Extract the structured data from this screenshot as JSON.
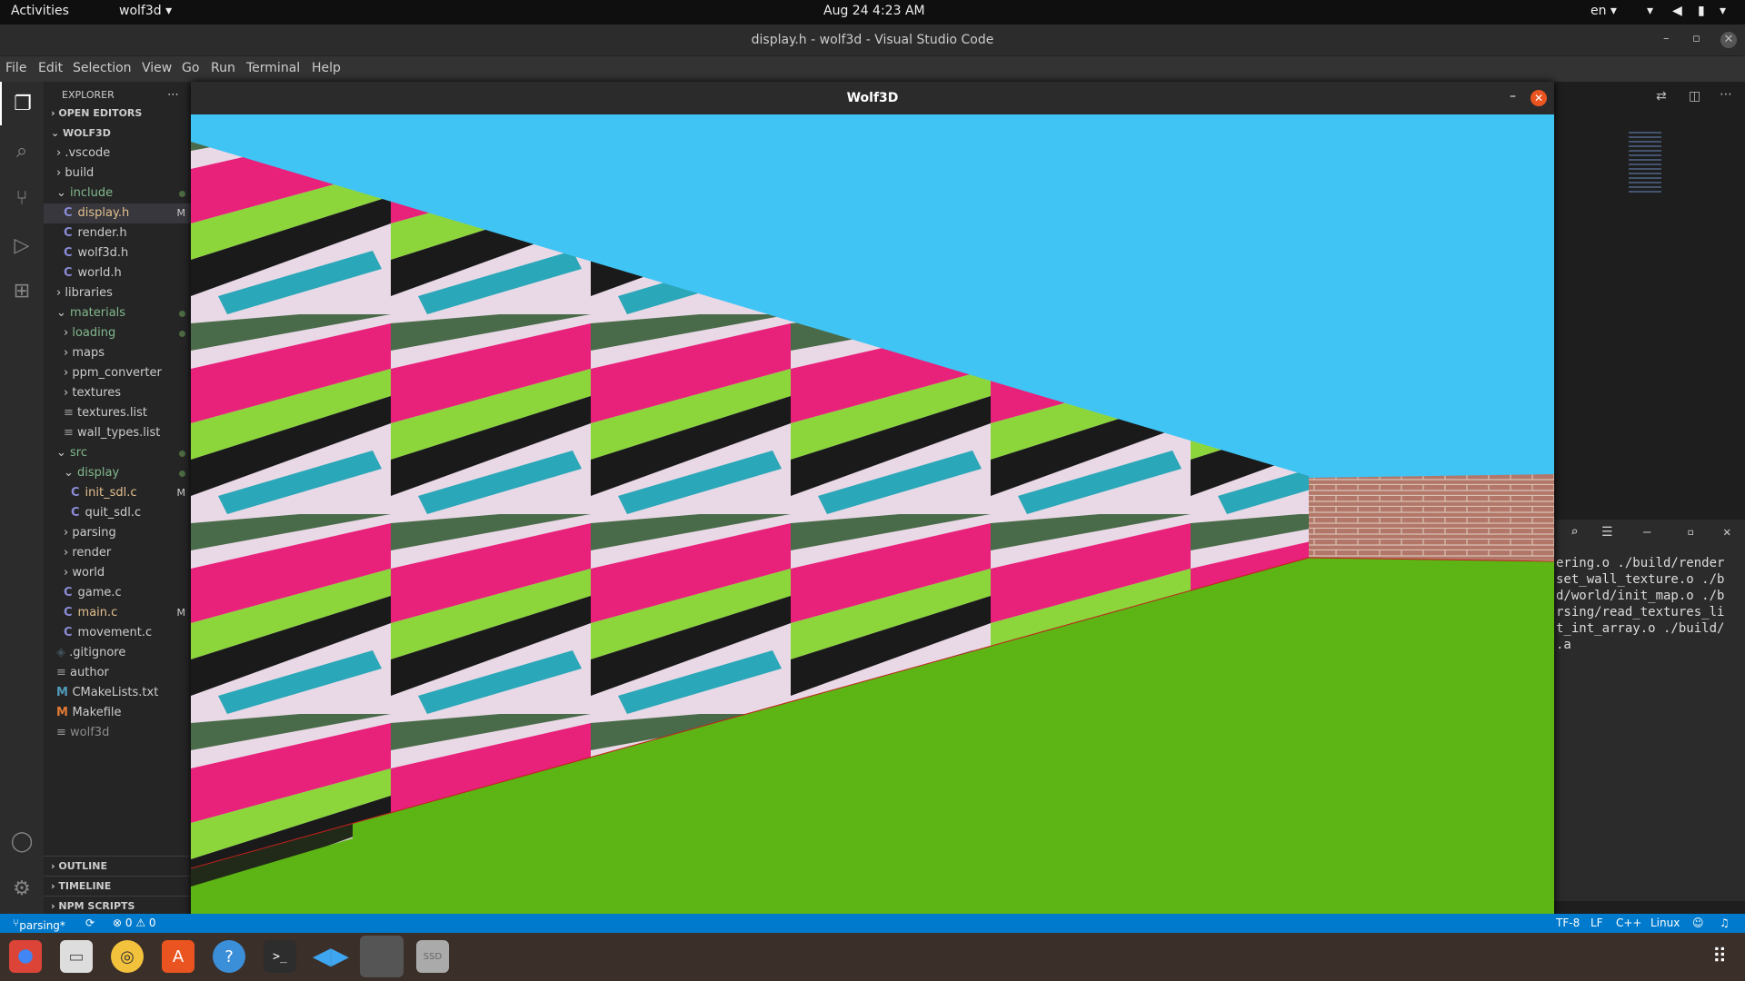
{
  "top_bar": {
    "activities": "Activities",
    "app": "wolf3d ▾",
    "clock": "Aug 24  4:23 AM",
    "lang": "en ▾"
  },
  "title_bar": {
    "title": "display.h - wolf3d - Visual Studio Code"
  },
  "menu": [
    "File",
    "Edit",
    "Selection",
    "View",
    "Go",
    "Run",
    "Terminal",
    "Help"
  ],
  "explorer": {
    "header": "EXPLORER",
    "open_editors": "OPEN EDITORS",
    "root": "WOLF3D",
    "items": [
      {
        "label": ".vscode",
        "kind": "folder"
      },
      {
        "label": "build",
        "kind": "folder"
      },
      {
        "label": "include",
        "kind": "folder-open",
        "git": "dot"
      },
      {
        "label": "display.h",
        "kind": "c",
        "git": "M",
        "selected": true
      },
      {
        "label": "render.h",
        "kind": "c"
      },
      {
        "label": "wolf3d.h",
        "kind": "c"
      },
      {
        "label": "world.h",
        "kind": "c"
      },
      {
        "label": "libraries",
        "kind": "folder"
      },
      {
        "label": "materials",
        "kind": "folder-open",
        "git": "dot"
      },
      {
        "label": "loading",
        "kind": "folder",
        "git": "dot"
      },
      {
        "label": "maps",
        "kind": "folder"
      },
      {
        "label": "ppm_converter",
        "kind": "folder"
      },
      {
        "label": "textures",
        "kind": "folder"
      },
      {
        "label": "textures.list",
        "kind": "text"
      },
      {
        "label": "wall_types.list",
        "kind": "text"
      },
      {
        "label": "src",
        "kind": "folder-open",
        "git": "dot"
      },
      {
        "label": "display",
        "kind": "folder-open",
        "git": "dot"
      },
      {
        "label": "init_sdl.c",
        "kind": "c",
        "git": "M"
      },
      {
        "label": "quit_sdl.c",
        "kind": "c"
      },
      {
        "label": "parsing",
        "kind": "folder"
      },
      {
        "label": "render",
        "kind": "folder"
      },
      {
        "label": "world",
        "kind": "folder"
      },
      {
        "label": "game.c",
        "kind": "c"
      },
      {
        "label": "main.c",
        "kind": "c",
        "git": "M"
      },
      {
        "label": "movement.c",
        "kind": "c"
      },
      {
        "label": ".gitignore",
        "kind": "git"
      },
      {
        "label": "author",
        "kind": "text"
      },
      {
        "label": "CMakeLists.txt",
        "kind": "m"
      },
      {
        "label": "Makefile",
        "kind": "m"
      },
      {
        "label": "wolf3d",
        "kind": "text"
      }
    ],
    "outline": "OUTLINE",
    "timeline": "TIMELINE",
    "npm": "NPM SCRIPTS"
  },
  "game_window": {
    "title": "Wolf3D"
  },
  "terminal": {
    "lines": [
      "ering.o ./build/render",
      "set_wall_texture.o ./b",
      "d/world/init_map.o ./b",
      "rsing/read_textures_li",
      "t_int_array.o ./build/",
      ".a"
    ]
  },
  "status": {
    "branch": "parsing*",
    "problems": "⊗ 0 ⚠ 0",
    "encoding": "TF-8",
    "eol": "LF",
    "lang": "C++",
    "os": "Linux"
  },
  "colors": {
    "sky": "#40c4f4",
    "floor": "#5cb514",
    "accent": "#007acc"
  }
}
